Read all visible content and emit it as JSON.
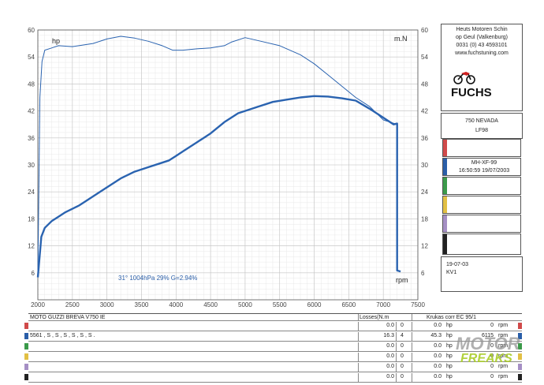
{
  "chart_data": {
    "type": "line",
    "xlabel": "rpm",
    "ylabel_left": "hp",
    "ylabel_right": "m.N",
    "xlim": [
      2000,
      7500
    ],
    "ylim": [
      0,
      60
    ],
    "x_ticks": [
      2000,
      2500,
      3000,
      3500,
      4000,
      4500,
      5000,
      5500,
      6000,
      6500,
      7000,
      7500
    ],
    "y_ticks": [
      6,
      12,
      18,
      24,
      30,
      36,
      42,
      48,
      54,
      60
    ],
    "grid": true,
    "annotation": "31°  1004hPa  29%   G=2.94%",
    "series": [
      {
        "role": "power",
        "color": "#2a63b0",
        "x": [
          2000,
          2050,
          2100,
          2200,
          2300,
          2400,
          2600,
          2800,
          3000,
          3200,
          3400,
          3600,
          3800,
          3900,
          4000,
          4100,
          4300,
          4500,
          4700,
          4900,
          5000,
          5200,
          5400,
          5600,
          5800,
          6000,
          6200,
          6400,
          6600,
          6800,
          7000,
          7150,
          7200,
          7200,
          7250
        ],
        "y": [
          5,
          14,
          16,
          17.5,
          18.5,
          19.5,
          21,
          23,
          25,
          27,
          28.5,
          29.5,
          30.5,
          31,
          32,
          33,
          35,
          37,
          39.5,
          41.5,
          42,
          43,
          44,
          44.5,
          45,
          45.3,
          45.2,
          44.8,
          44.3,
          42.5,
          40.5,
          39,
          39.2,
          6.5,
          6.3
        ]
      },
      {
        "role": "torque",
        "color": "#2a63b0",
        "x": [
          2000,
          2030,
          2060,
          2100,
          2200,
          2300,
          2500,
          2800,
          3000,
          3200,
          3400,
          3600,
          3800,
          3950,
          4100,
          4300,
          4500,
          4700,
          4800,
          5000,
          5200,
          5500,
          5800,
          6000,
          6200,
          6400,
          6600,
          6800,
          7000,
          7200
        ],
        "y": [
          5,
          45,
          53,
          55.5,
          56,
          56.5,
          56.3,
          57,
          58,
          58.6,
          58.2,
          57.5,
          56.5,
          55.5,
          55.5,
          55.8,
          56,
          56.5,
          57.3,
          58.3,
          57.6,
          56.5,
          54.5,
          52.5,
          50,
          47.5,
          45,
          43,
          40,
          39
        ]
      }
    ]
  },
  "sidebar": {
    "company": [
      "Heuts Motoren Schin",
      "op Geul  (Valkenburg)",
      "0031 (0) 43 4593101",
      "www.fuchstuning.com"
    ],
    "logo_text": "FUCHS",
    "model": "750 NEVADA",
    "code": "LF98",
    "box_red": "",
    "box_blue_1": "MH-XF-99",
    "box_blue_2": "16:50:59   19/07/2003",
    "box_green": "",
    "box_yellow": "",
    "box_purple": "",
    "box_black": "",
    "date": "19-07-03",
    "run": "KV1",
    "colors": {
      "red": "#d04a4a",
      "blue": "#2a5ea8",
      "green": "#3b9a4a",
      "yellow": "#e2c044",
      "purple": "#a58fc4",
      "black": "#222222"
    }
  },
  "table": {
    "header_left": "MOTO GUZZI BREVA  V750 IE",
    "header_losses": "Losses(N.m",
    "header_right": "Krukas corr EC 95/1",
    "rows": [
      {
        "swatch": "#d04a4a",
        "label": "",
        "loss": "0.0",
        "n": "0",
        "hp": "0.0",
        "hp_unit": "hp",
        "rpm": "0",
        "rpm_unit": "rpm"
      },
      {
        "swatch": "#2a5ea8",
        "label": "5561 , S , S , S , S , S , S .",
        "loss": "16.3",
        "n": "4",
        "hp": "45.3",
        "hp_unit": "hp",
        "rpm": "6115",
        "rpm_unit": "rpm"
      },
      {
        "swatch": "#3b9a4a",
        "label": "",
        "loss": "0.0",
        "n": "0",
        "hp": "0.0",
        "hp_unit": "hp",
        "rpm": "0",
        "rpm_unit": "rpm"
      },
      {
        "swatch": "#e2c044",
        "label": "",
        "loss": "0.0",
        "n": "0",
        "hp": "0.0",
        "hp_unit": "hp",
        "rpm": "0",
        "rpm_unit": "rpm"
      },
      {
        "swatch": "#a58fc4",
        "label": "",
        "loss": "0.0",
        "n": "0",
        "hp": "0.0",
        "hp_unit": "hp",
        "rpm": "0",
        "rpm_unit": "rpm"
      },
      {
        "swatch": "#222222",
        "label": "",
        "loss": "0.0",
        "n": "0",
        "hp": "0.0",
        "hp_unit": "hp",
        "rpm": "0",
        "rpm_unit": "rpm"
      }
    ]
  },
  "watermark": {
    "line1": "MOTOR",
    "line2": "FREAKS"
  }
}
